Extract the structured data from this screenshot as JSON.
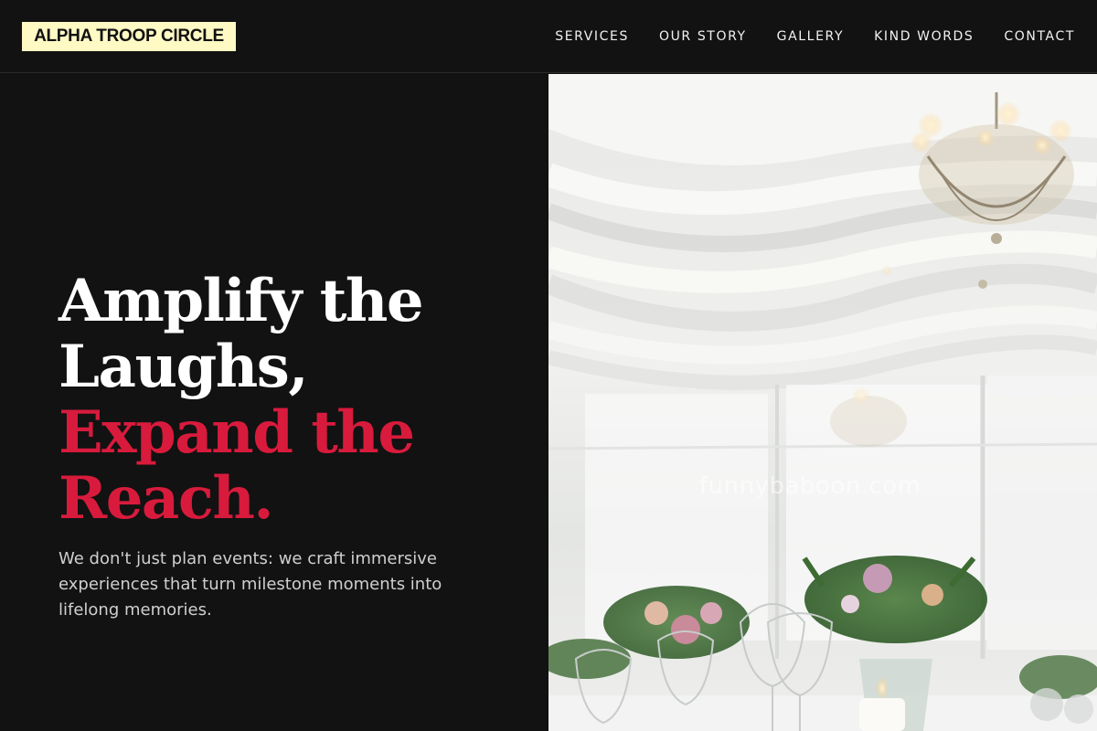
{
  "header": {
    "logo_text": "ALPHA TROOP CIRCLE",
    "nav": [
      {
        "label": "SERVICES"
      },
      {
        "label": "OUR STORY"
      },
      {
        "label": "GALLERY"
      },
      {
        "label": "KIND WORDS"
      },
      {
        "label": "CONTACT"
      }
    ]
  },
  "hero": {
    "headline_line1": "Amplify the Laughs,",
    "headline_line2": "Expand the Reach.",
    "subtext": "We don't just plan events: we craft immersive experiences that turn milestone moments into lifelong memories.",
    "image": {
      "watermark": "funnybaboon.com"
    }
  },
  "colors": {
    "background": "#121212",
    "logo_bg": "#fff9c4",
    "accent": "#d81b3c",
    "headline": "#ffffff",
    "body_text": "#cfcfcf"
  }
}
